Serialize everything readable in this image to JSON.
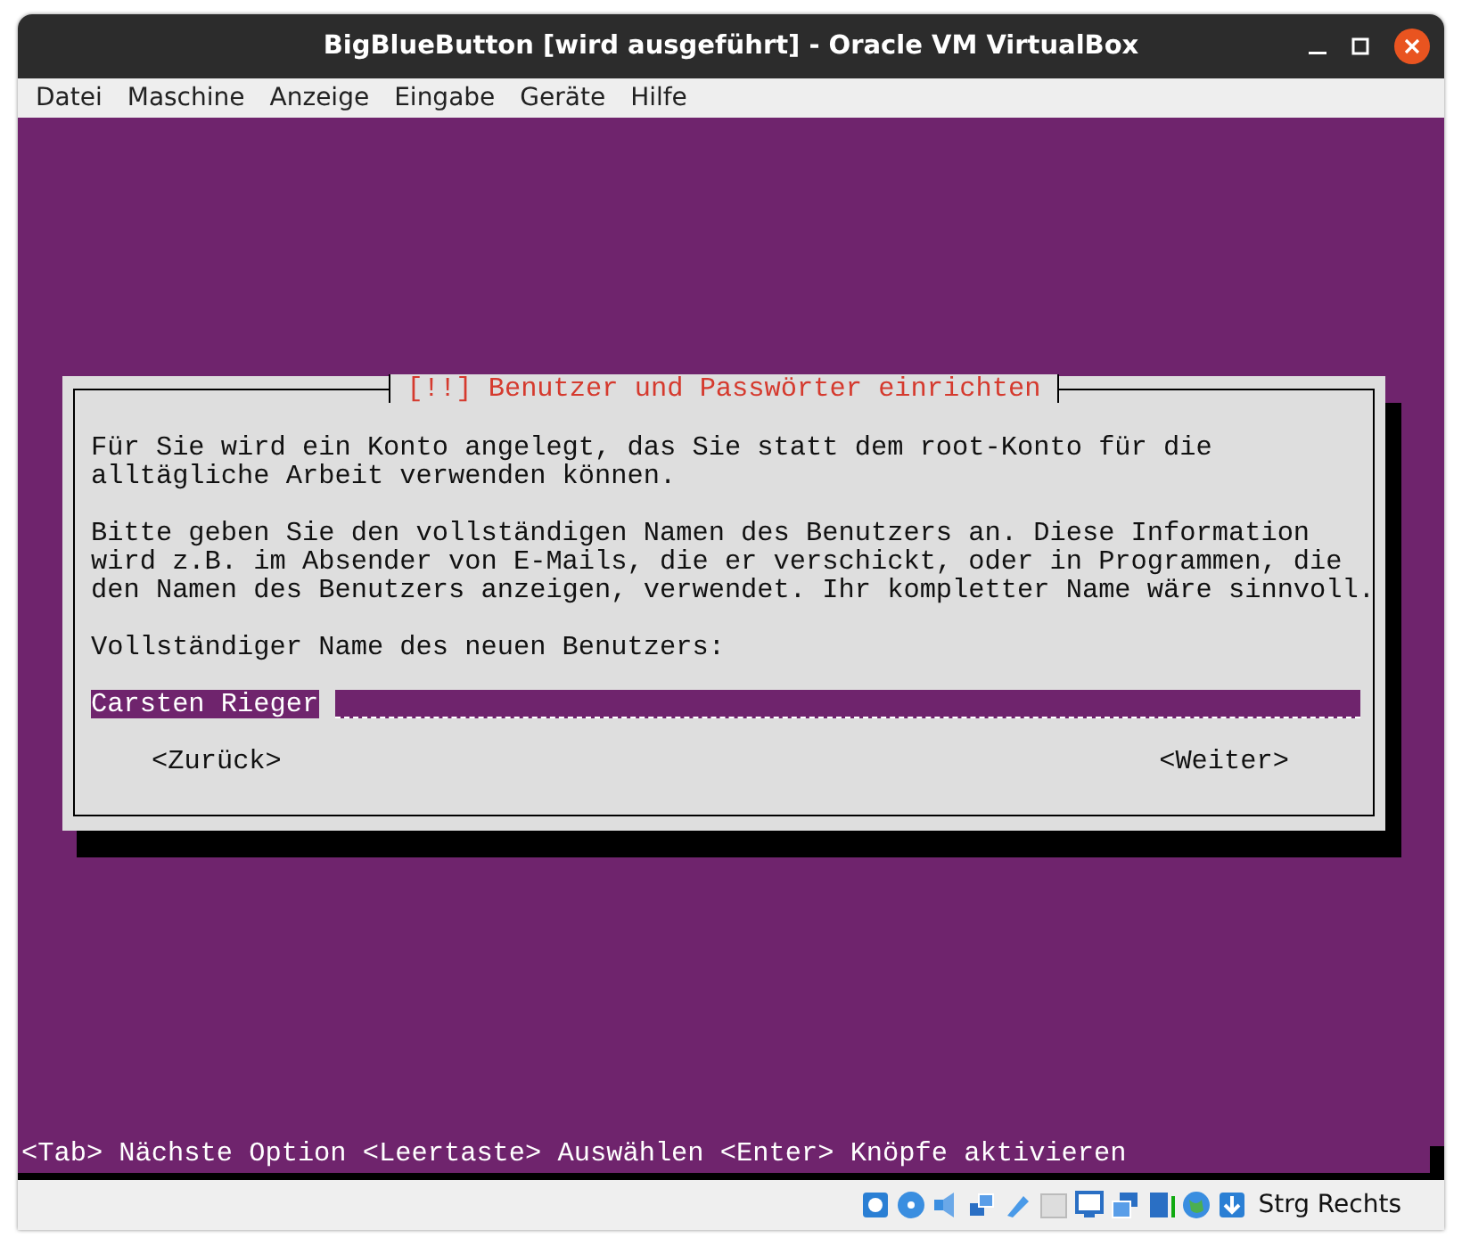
{
  "window": {
    "title": "BigBlueButton [wird ausgeführt] - Oracle VM VirtualBox"
  },
  "menu": [
    "Datei",
    "Maschine",
    "Anzeige",
    "Eingabe",
    "Geräte",
    "Hilfe"
  ],
  "dialog": {
    "title": "[!!] Benutzer und Passwörter einrichten",
    "paragraphs": [
      "Für Sie wird ein Konto angelegt, das Sie statt dem root-Konto für die alltägliche Arbeit verwenden können.",
      "Bitte geben Sie den vollständigen Namen des Benutzers an. Diese Information wird z.B. im Absender von E-Mails, die er verschickt, oder in Programmen, die den Namen des Benutzers anzeigen, verwendet. Ihr kompletter Name wäre sinnvoll.",
      "Vollständiger Name des neuen Benutzers:"
    ],
    "field": {
      "value": "Carsten Rieger"
    },
    "buttons": [
      "<Zurück>",
      "<Weiter>"
    ]
  },
  "hint": "<Tab> Nächste Option <Leertaste> Auswählen <Enter> Knöpfe aktivieren",
  "status_bar": {
    "host_key": "Strg Rechts"
  }
}
